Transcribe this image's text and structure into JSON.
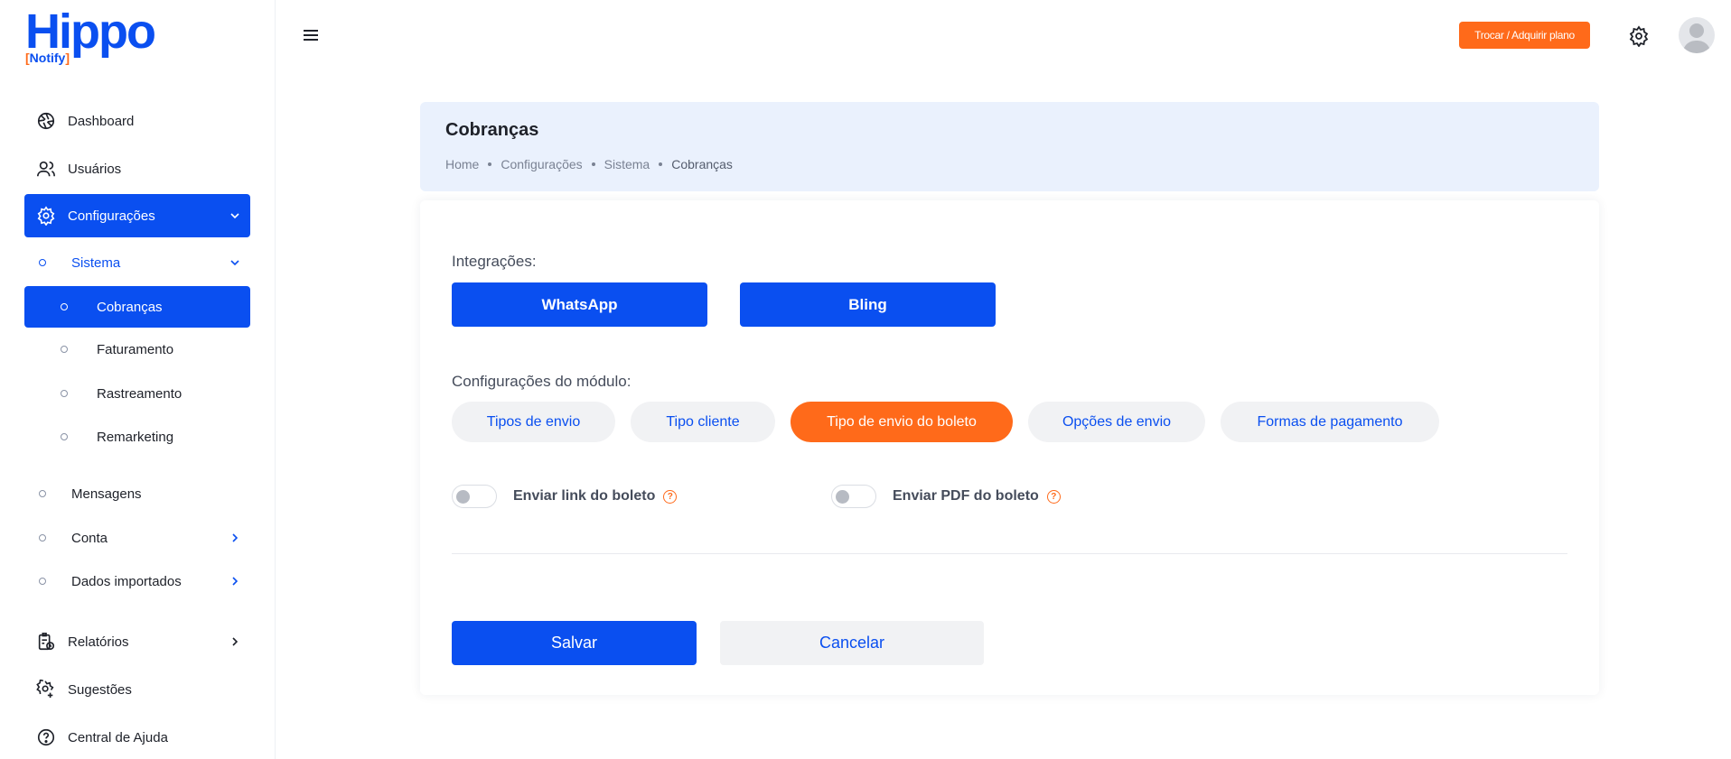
{
  "brand": {
    "name": "Hippo",
    "sub_open": "[",
    "sub": "Notify",
    "sub_close": "]",
    "color_primary": "#0a4ff0",
    "color_accent": "#ff6a1a"
  },
  "sidebar": {
    "items": [
      {
        "label": "Dashboard",
        "icon": "dashboard-icon"
      },
      {
        "label": "Usuários",
        "icon": "users-icon"
      },
      {
        "label": "Configurações",
        "icon": "gear-icon"
      },
      {
        "label": "Relatórios",
        "icon": "report-icon"
      },
      {
        "label": "Sugestões",
        "icon": "suggestion-gear-icon"
      },
      {
        "label": "Central de Ajuda",
        "icon": "help-icon"
      }
    ],
    "config_sub": [
      {
        "label": "Sistema"
      },
      {
        "label": "Mensagens"
      },
      {
        "label": "Conta"
      },
      {
        "label": "Dados importados"
      }
    ],
    "sistema_sub": [
      {
        "label": "Cobranças"
      },
      {
        "label": "Faturamento"
      },
      {
        "label": "Rastreamento"
      },
      {
        "label": "Remarketing"
      }
    ]
  },
  "topbar": {
    "plan_button": "Trocar / Adquirir plano"
  },
  "page": {
    "title": "Cobranças",
    "breadcrumbs": [
      "Home",
      "Configurações",
      "Sistema",
      "Cobranças"
    ]
  },
  "card": {
    "integrations_label": "Integrações:",
    "integrations": [
      "WhatsApp",
      "Bling"
    ],
    "module_label": "Configurações do módulo:",
    "tabs": [
      "Tipos de envio",
      "Tipo cliente",
      "Tipo de envio do boleto",
      "Opções de envio",
      "Formas de pagamento"
    ],
    "active_tab": "Tipo de envio do boleto",
    "toggles": [
      {
        "label": "Enviar link do boleto",
        "on": false,
        "help": "?"
      },
      {
        "label": "Enviar PDF do boleto",
        "on": false,
        "help": "?"
      }
    ],
    "save_label": "Salvar",
    "cancel_label": "Cancelar"
  }
}
